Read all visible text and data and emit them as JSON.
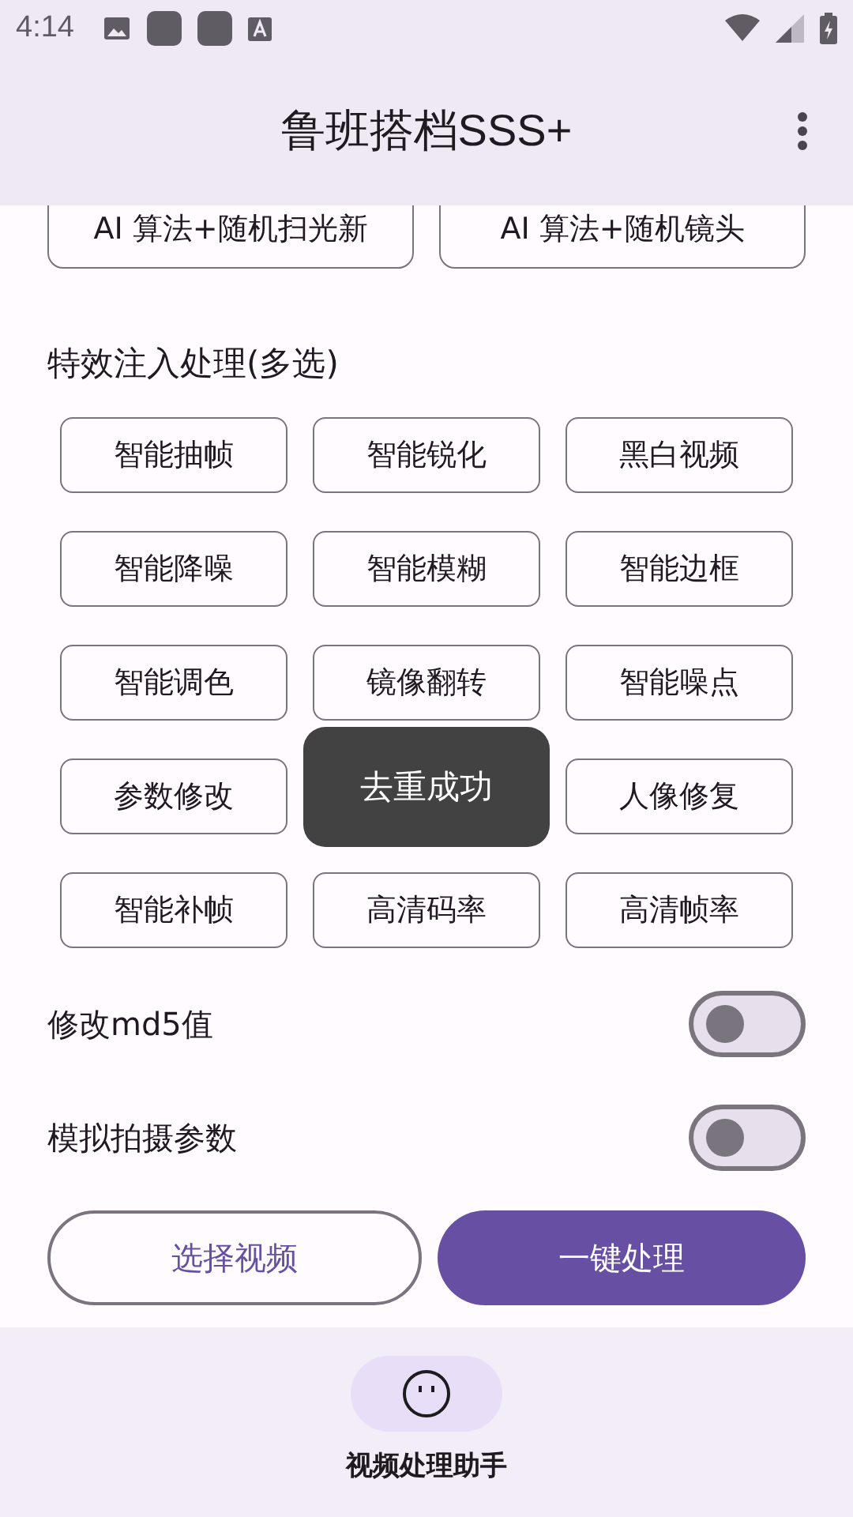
{
  "status_bar": {
    "time": "4:14"
  },
  "app_bar": {
    "title": "鲁班搭档SSS+"
  },
  "top_options": [
    {
      "label": "AI 算法+随机扫光新",
      "selected": false
    },
    {
      "label": "AI 算法+随机镜头",
      "selected": false
    }
  ],
  "effects": {
    "title": "特效注入处理(多选)",
    "options": [
      {
        "label": "智能抽帧",
        "selected": false
      },
      {
        "label": "智能锐化",
        "selected": false
      },
      {
        "label": "黑白视频",
        "selected": false
      },
      {
        "label": "智能降噪",
        "selected": false
      },
      {
        "label": "智能模糊",
        "selected": false
      },
      {
        "label": "智能边框",
        "selected": false
      },
      {
        "label": "智能调色",
        "selected": false
      },
      {
        "label": "镜像翻转",
        "selected": false
      },
      {
        "label": "智能噪点",
        "selected": false
      },
      {
        "label": "参数修改",
        "selected": false
      },
      {
        "label": "人像修复",
        "selected": false
      },
      {
        "label": "智能补帧",
        "selected": false
      },
      {
        "label": "高清码率",
        "selected": false
      },
      {
        "label": "高清帧率",
        "selected": false
      }
    ]
  },
  "switches": [
    {
      "label": "修改md5值",
      "on": false
    },
    {
      "label": "模拟拍摄参数",
      "on": false
    }
  ],
  "actions": {
    "secondary": "选择视频",
    "primary": "一键处理"
  },
  "toast": "去重成功",
  "bottom_nav": [
    {
      "label": "视频处理助手",
      "selected": true
    }
  ]
}
